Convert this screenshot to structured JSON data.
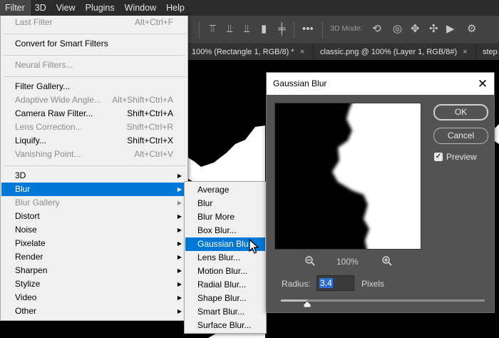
{
  "menubar": {
    "items": [
      "Filter",
      "3D",
      "View",
      "Plugins",
      "Window",
      "Help"
    ]
  },
  "options_bar": {
    "mode_label": "3D Mode:"
  },
  "tabs": [
    {
      "label": "100% (Rectangle 1, RGB/8) *",
      "close": "×"
    },
    {
      "label": "classic.png @ 100% (Layer 1, RGB/8#)",
      "close": "×"
    },
    {
      "label": "step",
      "close": ""
    }
  ],
  "filter_menu": {
    "last_filter": {
      "label": "Last Filter",
      "shortcut": "Alt+Ctrl+F"
    },
    "convert": {
      "label": "Convert for Smart Filters"
    },
    "neural": {
      "label": "Neural Filters..."
    },
    "group1": [
      {
        "label": "Filter Gallery...",
        "shortcut": ""
      },
      {
        "label": "Adaptive Wide Angle...",
        "shortcut": "Alt+Shift+Ctrl+A"
      },
      {
        "label": "Camera Raw Filter...",
        "shortcut": "Shift+Ctrl+A"
      },
      {
        "label": "Lens Correction...",
        "shortcut": "Shift+Ctrl+R"
      },
      {
        "label": "Liquify...",
        "shortcut": "Shift+Ctrl+X"
      },
      {
        "label": "Vanishing Point...",
        "shortcut": "Alt+Ctrl+V"
      }
    ],
    "group2": [
      {
        "label": "3D"
      },
      {
        "label": "Blur"
      },
      {
        "label": "Blur Gallery"
      },
      {
        "label": "Distort"
      },
      {
        "label": "Noise"
      },
      {
        "label": "Pixelate"
      },
      {
        "label": "Render"
      },
      {
        "label": "Sharpen"
      },
      {
        "label": "Stylize"
      },
      {
        "label": "Video"
      },
      {
        "label": "Other"
      }
    ]
  },
  "blur_submenu": {
    "items": [
      "Average",
      "Blur",
      "Blur More",
      "Box Blur...",
      "Gaussian Blur...",
      "Lens Blur...",
      "Motion Blur...",
      "Radial Blur...",
      "Shape Blur...",
      "Smart Blur...",
      "Surface Blur..."
    ],
    "selected": "Gaussian Blur..."
  },
  "dialog": {
    "title": "Gaussian Blur",
    "close": "✕",
    "ok_label": "OK",
    "cancel_label": "Cancel",
    "preview_label": "Preview",
    "preview_checked": true,
    "zoom_value": "100%",
    "radius_label": "Radius:",
    "radius_value": "3.4",
    "radius_unit": "Pixels",
    "radius_slider_fraction": 0.13
  }
}
